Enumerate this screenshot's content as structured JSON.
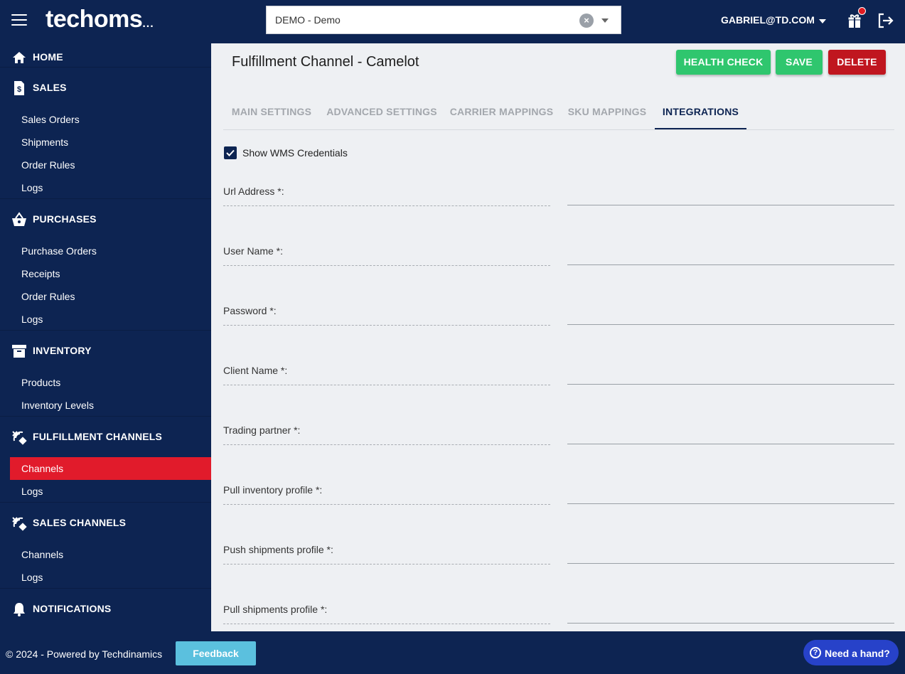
{
  "header": {
    "logo_text": "techoms",
    "logo_suffix": "...",
    "account_select_value": "DEMO - Demo",
    "user_email": "GABRIEL@TD.COM",
    "icons": [
      "menu-icon",
      "clear-icon",
      "chevron-down-icon",
      "gift-icon",
      "logout-icon"
    ]
  },
  "sidebar": {
    "sections": [
      {
        "label": "HOME",
        "icon": "home-icon",
        "items": []
      },
      {
        "label": "SALES",
        "icon": "sales-icon",
        "items": [
          "Sales Orders",
          "Shipments",
          "Order Rules",
          "Logs"
        ]
      },
      {
        "label": "PURCHASES",
        "icon": "basket-icon",
        "items": [
          "Purchase Orders",
          "Receipts",
          "Order Rules",
          "Logs"
        ]
      },
      {
        "label": "INVENTORY",
        "icon": "archive-icon",
        "items": [
          "Products",
          "Inventory Levels"
        ]
      },
      {
        "label": "FULFILLMENT CHANNELS",
        "icon": "channels-icon",
        "items": [
          "Channels",
          "Logs"
        ]
      },
      {
        "label": "SALES CHANNELS",
        "icon": "channels-icon",
        "items": [
          "Channels",
          "Logs"
        ]
      },
      {
        "label": "NOTIFICATIONS",
        "icon": "bell-icon",
        "items": []
      }
    ],
    "active_item": "Channels"
  },
  "main": {
    "title": "Fulfillment Channel - Camelot",
    "buttons": {
      "health_check": "HEALTH CHECK",
      "save": "SAVE",
      "delete": "DELETE"
    },
    "tabs": [
      "MAIN SETTINGS",
      "ADVANCED SETTINGS",
      "CARRIER MAPPINGS",
      "SKU MAPPINGS",
      "INTEGRATIONS"
    ],
    "active_tab": "INTEGRATIONS",
    "show_credentials_label": "Show WMS Credentials",
    "show_credentials_checked": true,
    "fields": [
      {
        "label": "Url Address *:",
        "value": ""
      },
      {
        "label": "User Name *:",
        "value": ""
      },
      {
        "label": "Password *:",
        "value": ""
      },
      {
        "label": "Client Name *:",
        "value": ""
      },
      {
        "label": "Trading partner *:",
        "value": ""
      },
      {
        "label": "Pull inventory profile *:",
        "value": ""
      },
      {
        "label": "Push shipments profile *:",
        "value": ""
      },
      {
        "label": "Pull shipments profile *:",
        "value": ""
      }
    ]
  },
  "footer": {
    "copyright": "© 2024 - Powered by Techdinamics",
    "feedback_label": "Feedback",
    "help_label": "Need a hand?"
  },
  "colors": {
    "navy": "#0d2452",
    "active_red": "#e11b2b",
    "green": "#2fc66e",
    "delete_red": "#c0161f",
    "feedback_blue": "#5bc0de",
    "help_blue": "#2742c9"
  }
}
